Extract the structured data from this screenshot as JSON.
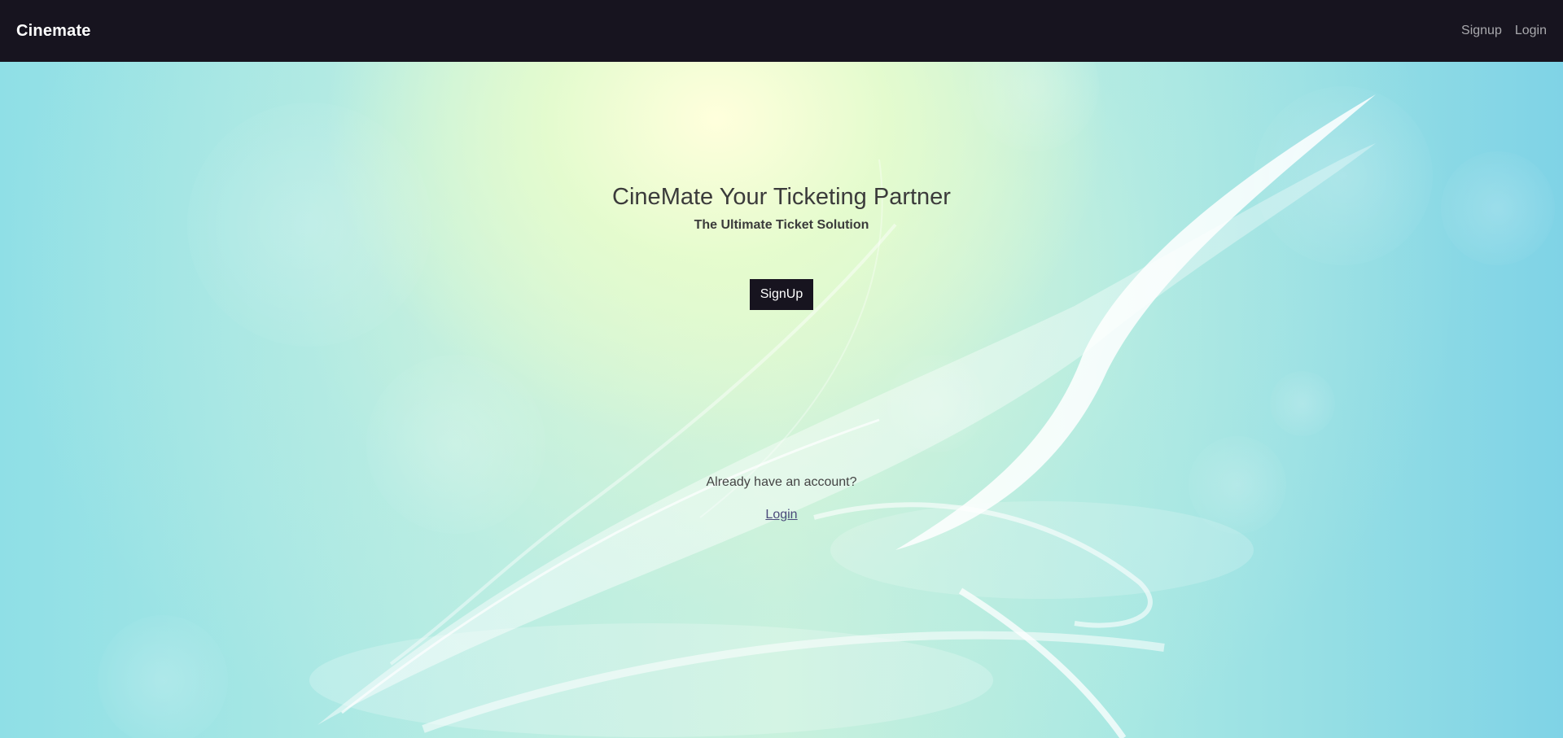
{
  "navbar": {
    "brand": "Cinemate",
    "links": [
      {
        "label": "Signup"
      },
      {
        "label": "Login"
      }
    ]
  },
  "hero": {
    "title": "CineMate Your Ticketing Partner",
    "subtitle": "The Ultimate Ticket Solution",
    "signup_button": "SignUp",
    "account_prompt": "Already have an account?",
    "login_link": "Login"
  },
  "colors": {
    "navbar_bg": "#17141f",
    "button_bg": "#17141f",
    "background_accent": "#8ad9e6"
  }
}
